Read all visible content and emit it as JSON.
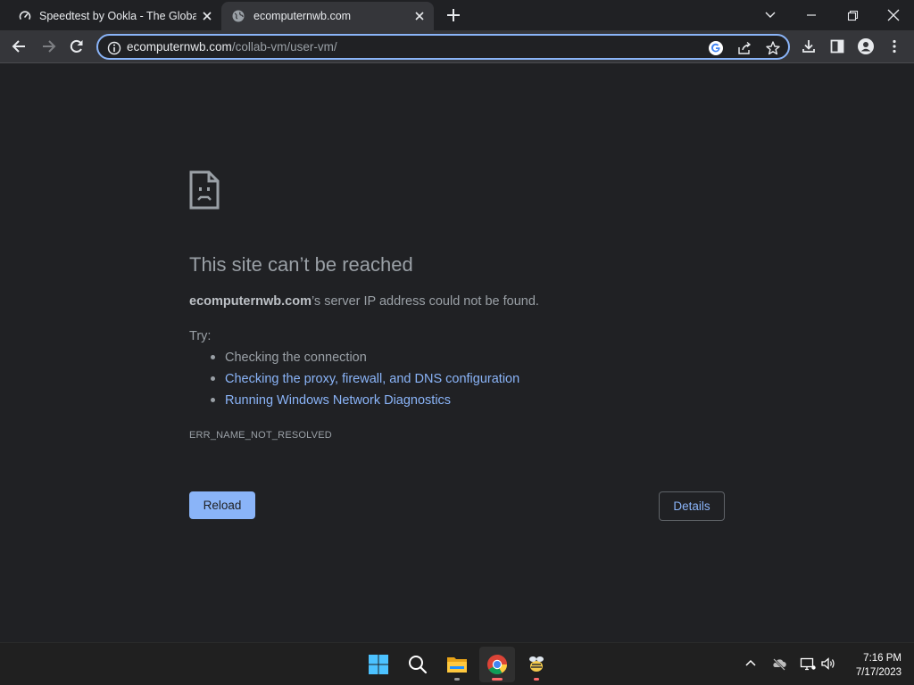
{
  "browser": {
    "tabs": [
      {
        "title": "Speedtest by Ookla - The Global",
        "active": false,
        "favicon": "speedtest-icon"
      },
      {
        "title": "ecomputernwb.com",
        "active": true,
        "favicon": "globe-icon"
      }
    ],
    "address": {
      "domain": "ecomputernwb.com",
      "path": "/collab-vm/user-vm/"
    }
  },
  "error_page": {
    "headline": "This site can’t be reached",
    "summary_host": "ecomputernwb.com",
    "summary_rest": "’s server IP address could not be found.",
    "try_label": "Try:",
    "suggestions": [
      {
        "text": "Checking the connection",
        "link": false
      },
      {
        "text": "Checking the proxy, firewall, and DNS configuration",
        "link": true
      },
      {
        "text": "Running Windows Network Diagnostics",
        "link": true
      }
    ],
    "error_code": "ERR_NAME_NOT_RESOLVED",
    "reload_label": "Reload",
    "details_label": "Details"
  },
  "taskbar": {
    "time": "7:16 PM",
    "date": "7/17/2023"
  },
  "colors": {
    "accent": "#8ab4f8",
    "page_bg": "#202124",
    "toolbar_bg": "#35363a"
  }
}
